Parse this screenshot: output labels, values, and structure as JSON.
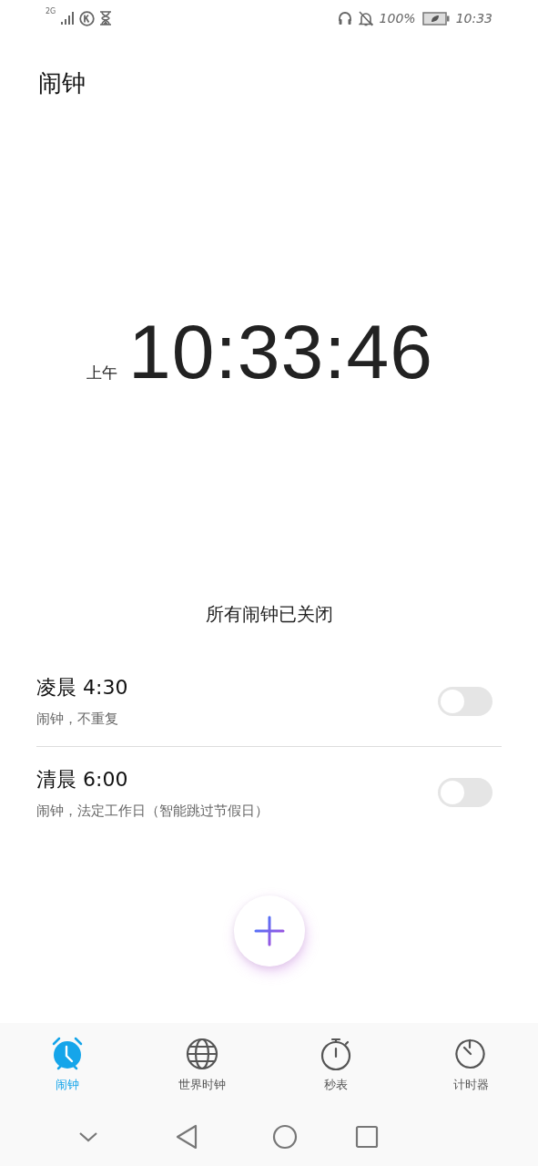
{
  "status_bar": {
    "network": "2G",
    "battery": "100%",
    "time": "10:33"
  },
  "header": {
    "title": "闹钟"
  },
  "clock": {
    "period": "上午",
    "time": "10:33:46"
  },
  "summary": "所有闹钟已关闭",
  "alarms": [
    {
      "time": "凌晨 4:30",
      "description": "闹钟，不重复",
      "on": false
    },
    {
      "time": "清晨 6:00",
      "description": "闹钟，法定工作日（智能跳过节假日）",
      "on": false
    }
  ],
  "tabs": [
    {
      "kind": "alarm",
      "label": "闹钟",
      "selected": true
    },
    {
      "kind": "globe",
      "label": "世界时钟",
      "selected": false
    },
    {
      "kind": "stopwatch",
      "label": "秒表",
      "selected": false
    },
    {
      "kind": "timer",
      "label": "计时器",
      "selected": false
    }
  ]
}
